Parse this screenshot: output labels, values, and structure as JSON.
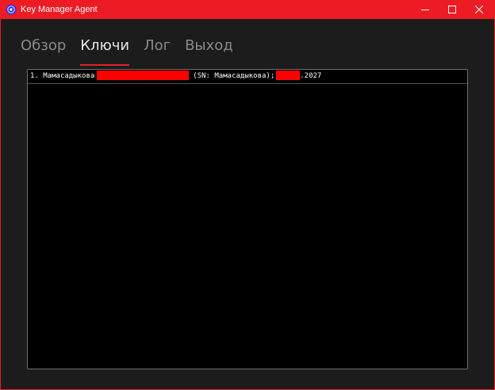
{
  "window": {
    "title": "Key Manager Agent",
    "accent_color": "#ed1c24",
    "icons": {
      "app": "shield-icon",
      "minimize": "minimize-icon",
      "maximize": "maximize-icon",
      "close": "close-icon"
    }
  },
  "tabs": [
    {
      "label": "Обзор",
      "active": false
    },
    {
      "label": "Ключи",
      "active": true
    },
    {
      "label": "Лог",
      "active": false
    },
    {
      "label": "Выход",
      "active": false
    }
  ],
  "keys_list": {
    "items": [
      {
        "index": "1.",
        "name": "Мамасадыкова",
        "sn_text": "(SN: Мамасадыкова);",
        "expiry_suffix": ".2027",
        "redaction_color": "#ff0000"
      }
    ]
  }
}
